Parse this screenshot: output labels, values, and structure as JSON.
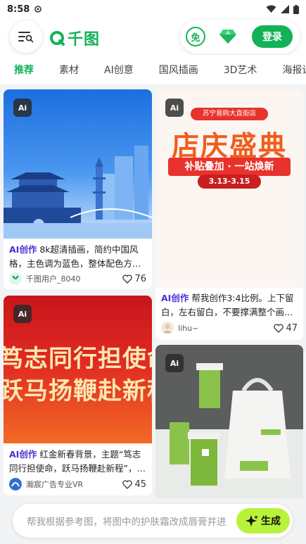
{
  "status": {
    "time": "8:58"
  },
  "header": {
    "logo_text": "千图",
    "free_label": "免",
    "login_label": "登录"
  },
  "tabs": [
    {
      "label": "推荐",
      "active": true
    },
    {
      "label": "素材"
    },
    {
      "label": "AI创意"
    },
    {
      "label": "国风插画"
    },
    {
      "label": "3D艺术"
    },
    {
      "label": "海报设"
    }
  ],
  "cards": [
    {
      "ai_badge": "Ai",
      "ai_tag": "AI创作",
      "text": "8k超清插画，简约中国风格，主色调为蓝色，整体配色方…",
      "user": "千图用户_8040",
      "likes": "76"
    },
    {
      "ai_badge": "Ai",
      "ai_tag": "AI创作",
      "text": "帮我创作3:4比例。上下留白，左右留白，不要撑满整个画…",
      "user": "lihu~",
      "likes": "47",
      "poster_top": "苏宁易购大直街店",
      "poster_title": "店庆盛典",
      "poster_sub": "补贴叠加 · 一站焕新",
      "poster_date": "3.13-3.15"
    },
    {
      "ai_badge": "Ai",
      "ai_tag": "AI创作",
      "text": "红金新春背景，主题“笃志同行担使命，跃马扬鞭赴新程”，…",
      "user": "瀚宸广告专业VR",
      "likes": "45",
      "banner_line1": "笃志同行担使命",
      "banner_line2": "跃马扬鞭赴新程"
    },
    {
      "ai_badge": "Ai"
    }
  ],
  "prompt": {
    "placeholder": "帮我根据参考图，将图中的护肤霜改成唇膏并进",
    "button_label": "生成"
  }
}
